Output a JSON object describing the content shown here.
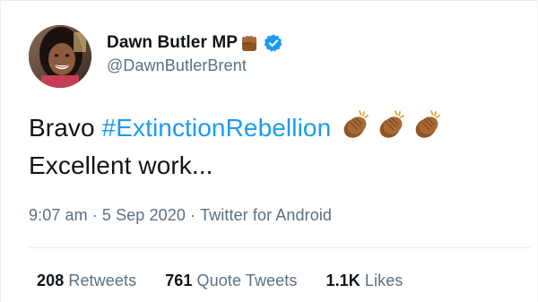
{
  "author": {
    "display_name": "Dawn Butler MP",
    "handle": "@DawnButlerBrent",
    "avatar_icon": "profile-photo",
    "name_emoji_icon": "raised-fist-icon",
    "verified_icon": "verified-badge-icon"
  },
  "tweet": {
    "text_before": "Bravo ",
    "hashtag": "#ExtinctionRebellion",
    "clap_emoji_count": 3,
    "clap_icon": "clapping-hands-icon",
    "text_after": "Excellent work..."
  },
  "meta": {
    "time": "9:07 am",
    "separator": "·",
    "date": "5 Sep 2020",
    "source": "Twitter for Android"
  },
  "stats": [
    {
      "count": "208",
      "label": "Retweets"
    },
    {
      "count": "761",
      "label": "Quote Tweets"
    },
    {
      "count": "1.1K",
      "label": "Likes"
    }
  ],
  "colors": {
    "link": "#1d9bf0",
    "secondary_text": "#5b7083",
    "primary_text": "#0f1419",
    "verified": "#1d9bf0",
    "divider": "#e6ecf0"
  }
}
